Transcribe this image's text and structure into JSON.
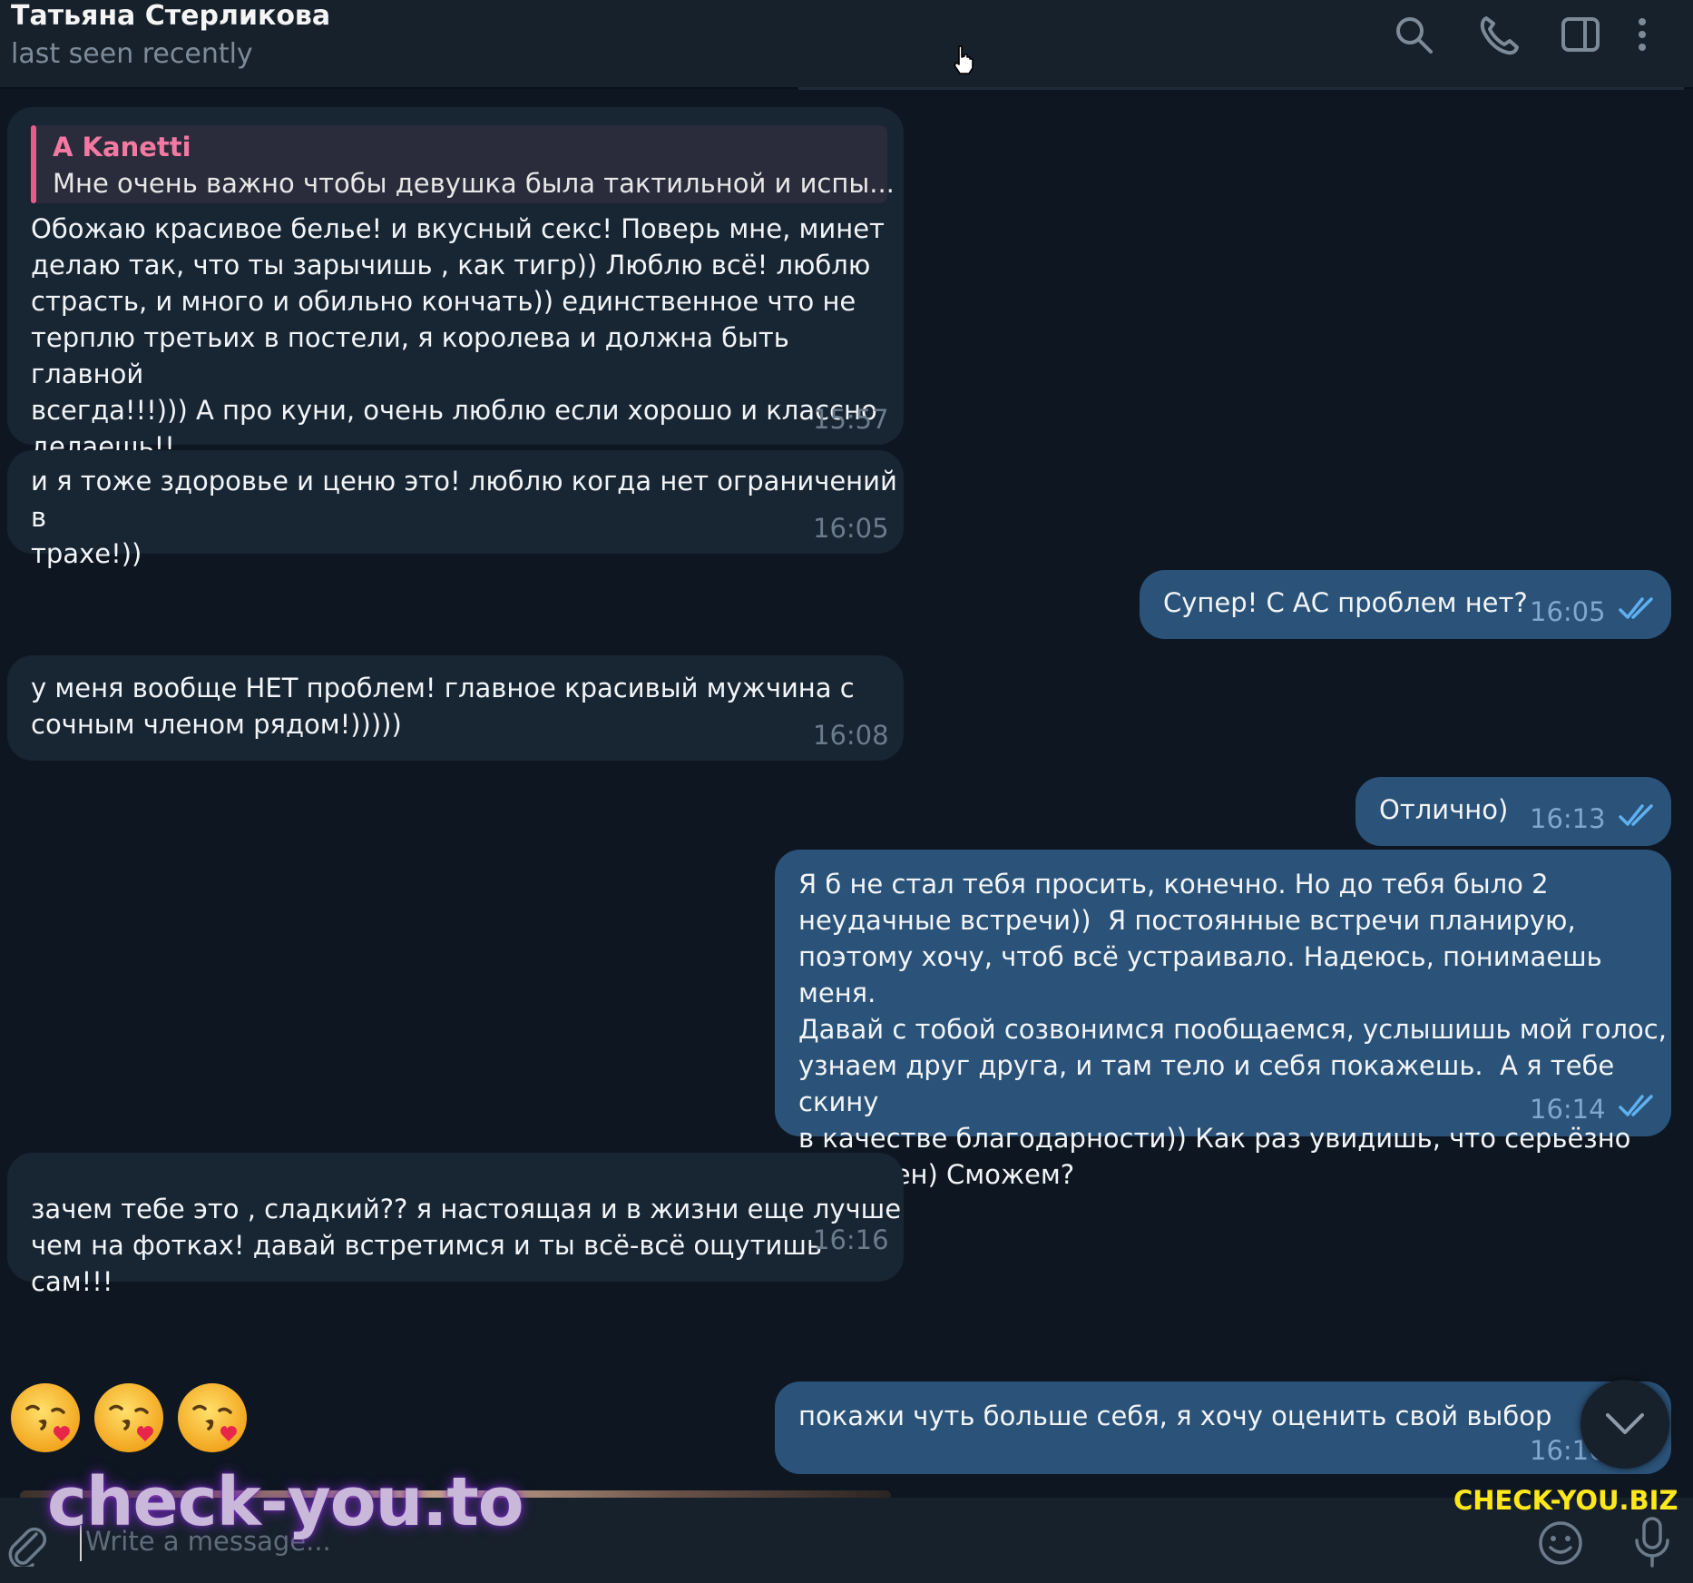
{
  "header": {
    "name": "Татьяна Стерликова",
    "status": "last seen recently"
  },
  "messages": [
    {
      "direction": "incoming",
      "reply": {
        "author": "A Kanetti",
        "text": "Мне очень важно чтобы девушка была тактильной и испы..."
      },
      "text": "Обожаю красивое белье! и вкусный секс! Поверь мне, минет\nделаю так, что ты зарычишь , как тигр)) Люблю всё! люблю\nстрасть, и много и обильно кончать)) единственное что не\nтерплю третьих в постели, я королева и должна быть главной\nвсегда!!!))) А про куни, очень люблю если хорошо и классно\nделаешь!!",
      "time": "15:57"
    },
    {
      "direction": "incoming",
      "text": "и я тоже здоровье и ценю это! люблю когда нет ограничений в\nтрахе!))",
      "time": "16:05"
    },
    {
      "direction": "outgoing",
      "text": "Супер! С АС проблем нет?",
      "time": "16:05",
      "read": true
    },
    {
      "direction": "incoming",
      "text": "у меня вообще НЕТ проблем! главное красивый мужчина с\nсочным членом рядом!)))))",
      "time": "16:08"
    },
    {
      "direction": "outgoing",
      "text": "Отлично)",
      "time": "16:13",
      "read": true
    },
    {
      "direction": "outgoing",
      "text": "Я б не стал тебя просить, конечно. Но до тебя было 2\nнеудачные встречи))  Я постоянные встречи планирую,\nпоэтому хочу, чтоб всё устраивало. Надеюсь, понимаешь меня.\nДавай с тобой созвонимся пообщаемся, услышишь мой голос,\nузнаем друг друга, и там тело и себя покажешь.  А я тебе скину\nв качестве благодарности)) Как раз увидишь, что серьёзно\nнастроен) Сможем?",
      "time": "16:14",
      "read": true
    },
    {
      "direction": "incoming",
      "text": "зачем тебе это , сладкий?? я настоящая и в жизни еще лучше\nчем на фотках! давай встретимся и ты всё-всё ощутишь сам!!!",
      "time": "16:16"
    },
    {
      "direction": "incoming",
      "emoji": "face-blowing-a-kiss x3"
    },
    {
      "direction": "outgoing",
      "text": "покажи чуть больше себя, я хочу оценить свой выбор",
      "time": "16:16"
    }
  ],
  "composer": {
    "placeholder": "Write a message..."
  },
  "watermarks": {
    "left": "check-you.to",
    "right": "CHECK-YOU.BIZ"
  },
  "colors": {
    "background": "#0e1621",
    "incoming_bubble": "#182533",
    "outgoing_bubble": "#2b5278",
    "reply_accent": "#e65d8c",
    "read_checks": "#5fb0f0"
  }
}
